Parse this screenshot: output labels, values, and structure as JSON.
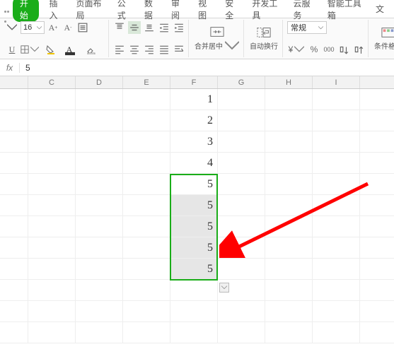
{
  "menu": {
    "active": "开始",
    "items": [
      "插入",
      "页面布局",
      "公式",
      "数据",
      "审阅",
      "视图",
      "安全",
      "开发工具",
      "云服务",
      "智能工具箱",
      "文"
    ]
  },
  "toolbar": {
    "fontsize": "16",
    "merge": "合并居中",
    "wrap": "自动换行",
    "numformat": "常规",
    "percent": "%",
    "thousand": "000",
    "condfmt": "条件格式"
  },
  "fx": {
    "value": "5"
  },
  "columns": [
    "C",
    "D",
    "E",
    "F",
    "G",
    "H",
    "I"
  ],
  "cells_f": [
    "1",
    "2",
    "3",
    "4",
    "5",
    "5",
    "5",
    "5",
    "5"
  ],
  "chart_data": {
    "type": "table",
    "title": "",
    "columns": [
      "F"
    ],
    "values": [
      1,
      2,
      3,
      4,
      5,
      5,
      5,
      5,
      5
    ],
    "selected_range": "F5:F9",
    "selected_values": [
      5,
      5,
      5,
      5,
      5
    ]
  }
}
